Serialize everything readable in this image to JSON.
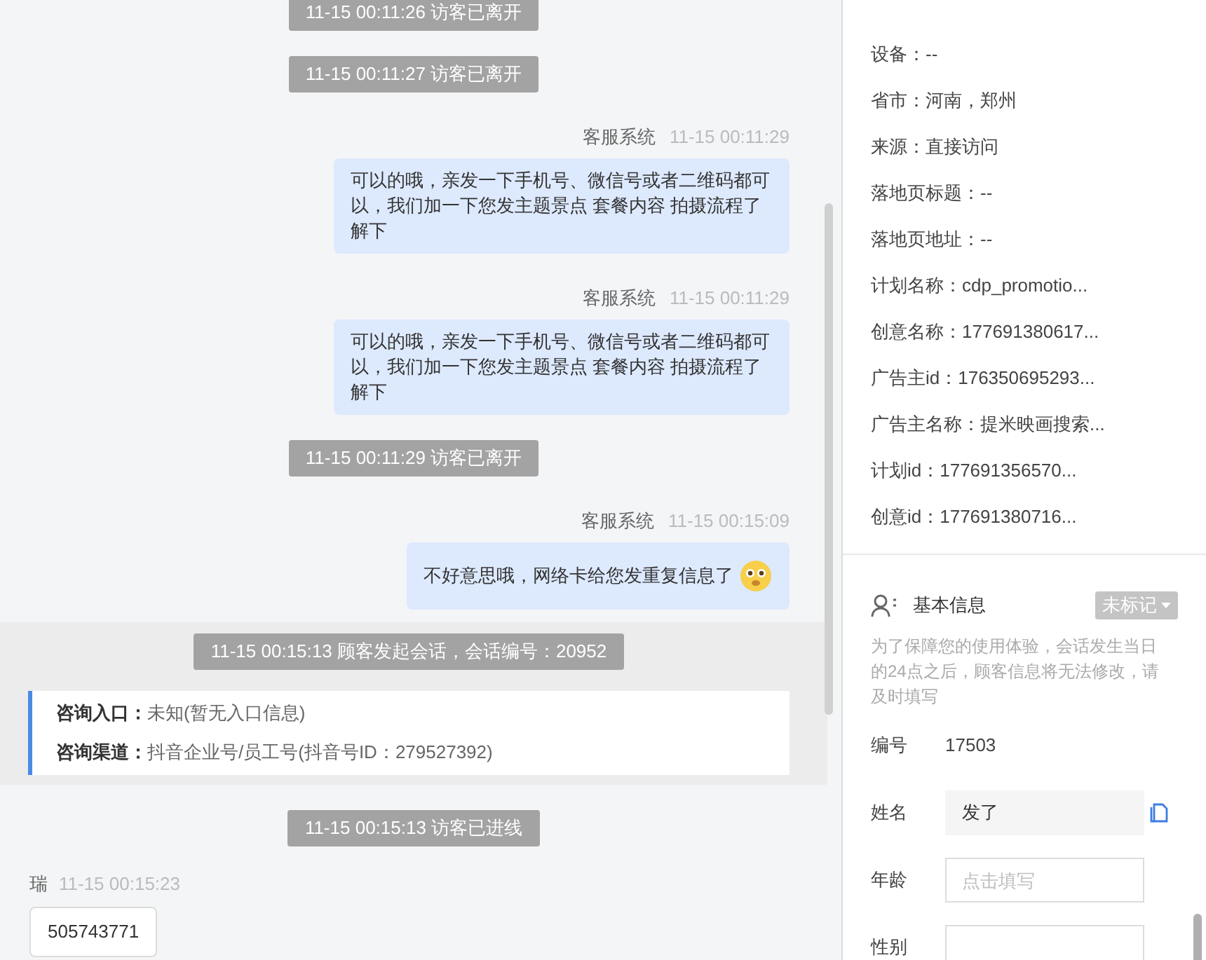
{
  "messages": [
    {
      "kind": "notice",
      "text": "11-15 00:11:26 访客已离开"
    },
    {
      "kind": "notice",
      "text": "11-15 00:11:27 访客已离开"
    },
    {
      "kind": "agent",
      "sender": "客服系统",
      "time": "11-15 00:11:29",
      "text": "可以的哦，亲发一下手机号、微信号或者二维码都可以，我们加一下您发主题景点 套餐内容 拍摄流程了解下"
    },
    {
      "kind": "agent",
      "sender": "客服系统",
      "time": "11-15 00:11:29",
      "text": "可以的哦，亲发一下手机号、微信号或者二维码都可以，我们加一下您发主题景点 套餐内容 拍摄流程了解下"
    },
    {
      "kind": "notice",
      "text": "11-15 00:11:29 访客已离开"
    },
    {
      "kind": "agent",
      "sender": "客服系统",
      "time": "11-15 00:15:09",
      "text": "不好意思哦，网络卡给您发重复信息了",
      "emoji": true
    },
    {
      "kind": "session",
      "text": "11-15 00:15:13 顾客发起会话，会话编号：20952",
      "entries": [
        {
          "label": "咨询入口：",
          "value": "未知(暂无入口信息)"
        },
        {
          "label": "咨询渠道：",
          "value": "抖音企业号/员工号(抖音号ID：279527392)"
        }
      ]
    },
    {
      "kind": "notice",
      "text": "11-15 00:15:13 访客已进线"
    },
    {
      "kind": "visitor",
      "sender": "瑞",
      "time": "11-15 00:15:23",
      "text": "505743771"
    }
  ],
  "visit_info": [
    "设备：--",
    "省市：河南，郑州",
    "来源：直接访问",
    "落地页标题：--",
    "落地页地址：--",
    "计划名称：cdp_promotio...",
    "创意名称：177691380617...",
    "广告主id：176350695293...",
    "广告主名称：提米映画搜索...",
    "计划id：177691356570...",
    "创意id：177691380716..."
  ],
  "basic_info": {
    "title": "基本信息",
    "tag": "未标记",
    "note": "为了保障您的使用体验，会话发生当日的24点之后，顾客信息将无法修改，请及时填写",
    "fields": [
      {
        "kind": "text",
        "label": "编号",
        "value": "17503"
      },
      {
        "kind": "locked",
        "label": "姓名",
        "value": "发了"
      },
      {
        "kind": "input",
        "label": "年龄",
        "placeholder": "点击填写"
      },
      {
        "kind": "input",
        "label": "性别"
      }
    ]
  }
}
